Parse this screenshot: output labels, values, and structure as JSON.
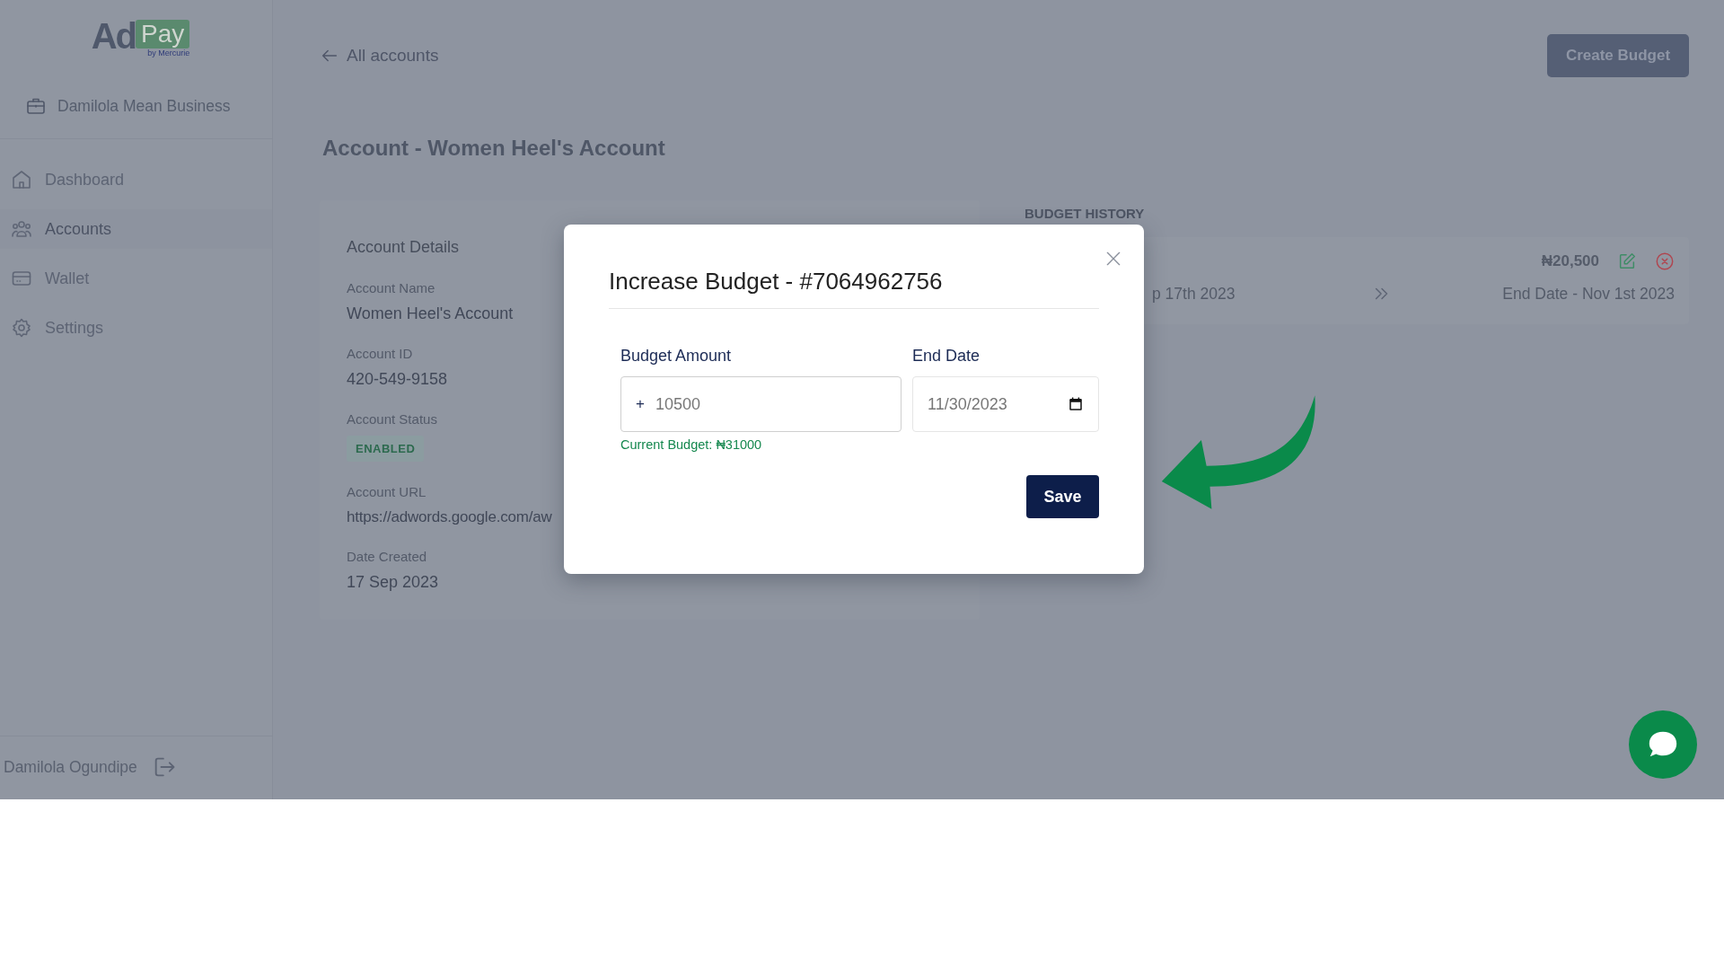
{
  "logo": {
    "word": "Ad",
    "badge": "Pay",
    "tagline": "by Mercurie"
  },
  "sidebar": {
    "business": "Damilola Mean Business",
    "items": [
      {
        "label": "Dashboard",
        "selected": false
      },
      {
        "label": "Accounts",
        "selected": true
      },
      {
        "label": "Wallet",
        "selected": false
      },
      {
        "label": "Settings",
        "selected": false
      }
    ],
    "user": "Damilola Ogundipe"
  },
  "header": {
    "back_link": "All accounts",
    "create_button": "Create Budget",
    "page_title": "Account - Women Heel's Account"
  },
  "account_details": {
    "title": "Account Details",
    "fields": [
      {
        "label": "Account Name",
        "value": "Women Heel's Account",
        "kind": "text"
      },
      {
        "label": "Account ID",
        "value": "420-549-9158",
        "kind": "text"
      },
      {
        "label": "Account Status",
        "value": "ENABLED",
        "kind": "badge"
      },
      {
        "label": "Account URL",
        "value": "https://adwords.google.com/aw",
        "kind": "link"
      },
      {
        "label": "Date Created",
        "value": "17 Sep 2023",
        "kind": "text"
      }
    ]
  },
  "budget_history": {
    "title": "BUDGET HISTORY",
    "entries": [
      {
        "amount": "₦20,500",
        "start": "p 17th 2023",
        "end": "End Date - Nov 1st 2023"
      }
    ]
  },
  "modal": {
    "title": "Increase Budget - #7064962756",
    "amount": {
      "label": "Budget Amount",
      "prefix": "+",
      "value": "10500",
      "hint": "Current Budget: ₦31000"
    },
    "end_date": {
      "label": "End Date",
      "value": "11/30/2023"
    },
    "save": "Save"
  }
}
